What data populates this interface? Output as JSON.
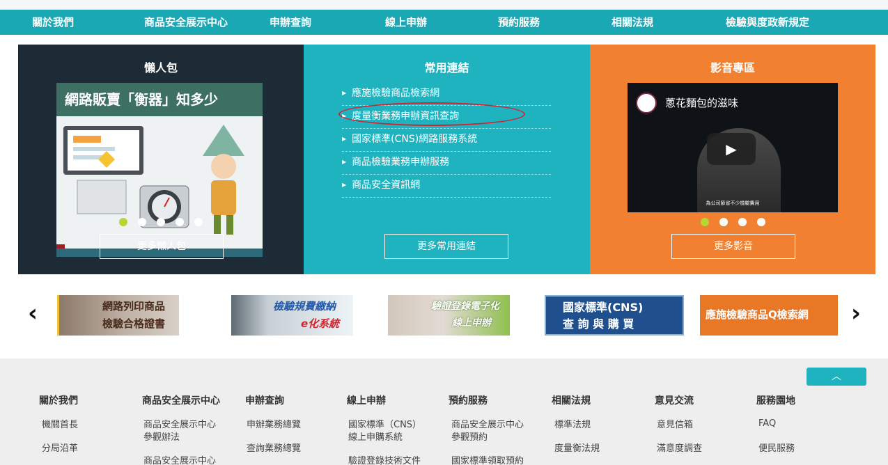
{
  "nav": {
    "items": [
      "關於我們",
      "商品安全展示中心",
      "申辦查詢",
      "線上申辦",
      "預約服務",
      "相關法規",
      "檢驗與度政新規定"
    ]
  },
  "panels": {
    "lazy": {
      "title": "懶人包",
      "image_title": "網路販賣「衡器」知多少",
      "more": "更多懶人包"
    },
    "links": {
      "title": "常用連結",
      "items": [
        "應施檢驗商品檢索網",
        "度量衡業務申辦資訊查詢",
        "國家標準(CNS)網路服務系統",
        "商品檢驗業務申辦服務",
        "商品安全資訊網"
      ],
      "more": "更多常用連結"
    },
    "video": {
      "title": "影音專區",
      "video_title": "蔥花麵包的滋味",
      "caption": "為公司節省不少檢驗費用",
      "more": "更多影音"
    }
  },
  "banners": [
    {
      "line1": "網路列印商品",
      "line2": "檢驗合格證書"
    },
    {
      "line1": "檢驗規費繳納",
      "line2": "e化系統"
    },
    {
      "line1": "驗證登錄電子化",
      "line2": "線上申辦"
    },
    {
      "line1": "國家標準(CNS)",
      "line2": "查 詢 與 購 買"
    },
    {
      "line1": "應施檢驗商品Q檢索網",
      "line2": ""
    }
  ],
  "footer": {
    "columns": [
      {
        "heading": "關於我們",
        "links": [
          "機關首長",
          "分局沿革"
        ]
      },
      {
        "heading": "商品安全展示中心",
        "links": [
          "商品安全展示中心\n參觀辦法",
          "商品安全展示中心"
        ]
      },
      {
        "heading": "申辦查詢",
        "links": [
          "申辦業務總覽",
          "查詢業務總覽"
        ]
      },
      {
        "heading": "線上申辦",
        "links": [
          "國家標準（CNS）\n線上申購系統",
          "驗證登錄技術文件"
        ]
      },
      {
        "heading": "預約服務",
        "links": [
          "商品安全展示中心\n參觀預約",
          "國家標準領取預約"
        ]
      },
      {
        "heading": "相關法規",
        "links": [
          "標準法規",
          "度量衡法規"
        ]
      },
      {
        "heading": "意見交流",
        "links": [
          "意見信箱",
          "滿意度調查"
        ]
      },
      {
        "heading": "服務園地",
        "links": [
          "FAQ",
          "便民服務"
        ]
      }
    ]
  },
  "colors": {
    "nav": "#1aa8b5",
    "panel_dark": "#1d2b36",
    "panel_teal": "#1fb3c0",
    "panel_orange": "#f18130",
    "highlight_circle": "#d4232f",
    "dot_active": "#b7d533"
  }
}
